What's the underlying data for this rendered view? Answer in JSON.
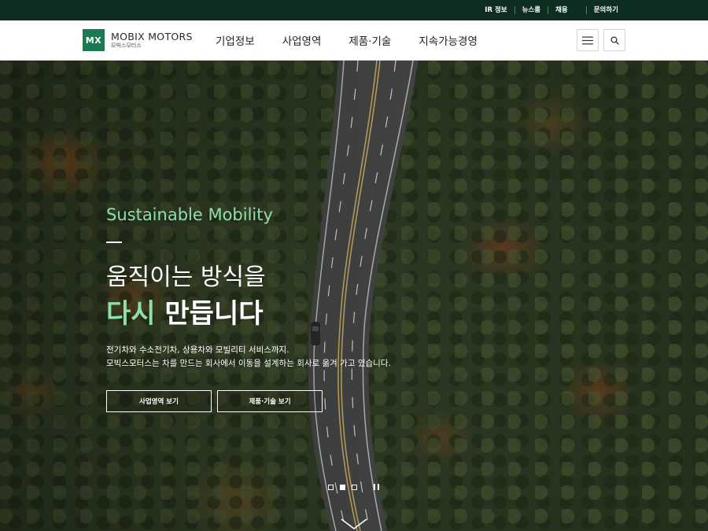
{
  "utility": {
    "links": [
      "IR 정보",
      "뉴스룸",
      "채용",
      "문의하기"
    ]
  },
  "brand": {
    "mark": "MX",
    "name": "MOBIX MOTORS",
    "sub": "모빅스모터스",
    "color": "#1a7a52"
  },
  "nav": {
    "items": [
      "기업정보",
      "사업영역",
      "제품·기술",
      "지속가능경영"
    ]
  },
  "header_icons": [
    "hamburger-menu-icon",
    "search-icon"
  ],
  "hero": {
    "eyebrow": "Sustainable Mobility",
    "headline_line1": "움직이는 방식을",
    "headline_accent": "다시",
    "headline_rest": " 만듭니다",
    "desc_line1": "전기차와 수소전기차, 상용차와 모빌리티 서비스까지.",
    "desc_line2": "모빅스모터스는 차를 만드는 회사에서 이동을 설계하는 회사로 옮겨 가고 있습니다.",
    "cta_primary": "사업영역 보기",
    "cta_secondary": "제품·기술 보기",
    "accent_color": "#8fe0a8"
  },
  "slider": {
    "total": 3,
    "active_index": 1,
    "icons": [
      "pause-icon",
      "chevron-down-icon"
    ]
  },
  "colors": {
    "utility_bg": "#0f2e22",
    "header_bg": "#ffffff"
  }
}
